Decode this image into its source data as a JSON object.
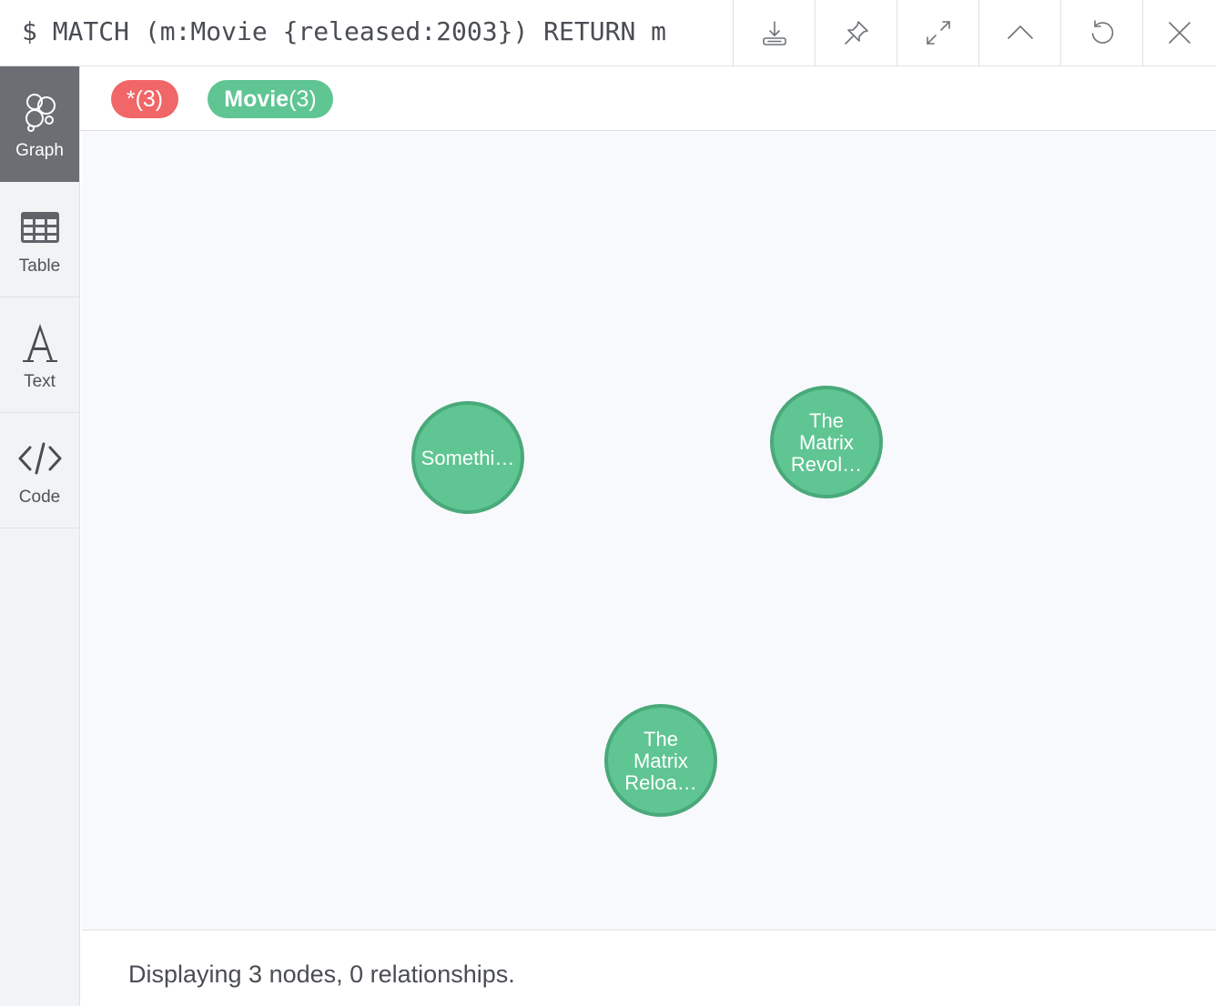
{
  "query": {
    "text": "$ MATCH (m:Movie {released:2003}) RETURN m"
  },
  "toolbar": {
    "buttons": [
      {
        "name": "download-button",
        "icon": "download-icon"
      },
      {
        "name": "pin-button",
        "icon": "pin-icon"
      },
      {
        "name": "fullscreen-button",
        "icon": "expand-icon"
      },
      {
        "name": "collapse-button",
        "icon": "chevron-up-icon"
      },
      {
        "name": "rerun-button",
        "icon": "refresh-icon"
      },
      {
        "name": "close-button",
        "icon": "close-icon"
      }
    ]
  },
  "sidebar": {
    "items": [
      {
        "label": "Graph",
        "icon": "graph-icon",
        "active": true
      },
      {
        "label": "Table",
        "icon": "table-icon",
        "active": false
      },
      {
        "label": "Text",
        "icon": "text-icon",
        "active": false
      },
      {
        "label": "Code",
        "icon": "code-icon",
        "active": false
      }
    ]
  },
  "legend": {
    "all": {
      "label": "*",
      "count": "(3)",
      "color": "#f16667"
    },
    "movie": {
      "label": "Movie",
      "count": "(3)",
      "color": "#5fc592"
    }
  },
  "graph": {
    "node_color": "#5fc592",
    "node_border": "#4aa97a",
    "nodes": [
      {
        "label_lines": [
          "Somethi…"
        ]
      },
      {
        "label_lines": [
          "The",
          "Matrix",
          "Revol…"
        ]
      },
      {
        "label_lines": [
          "The",
          "Matrix",
          "Reloa…"
        ]
      }
    ]
  },
  "status": {
    "text": "Displaying 3 nodes, 0 relationships."
  }
}
